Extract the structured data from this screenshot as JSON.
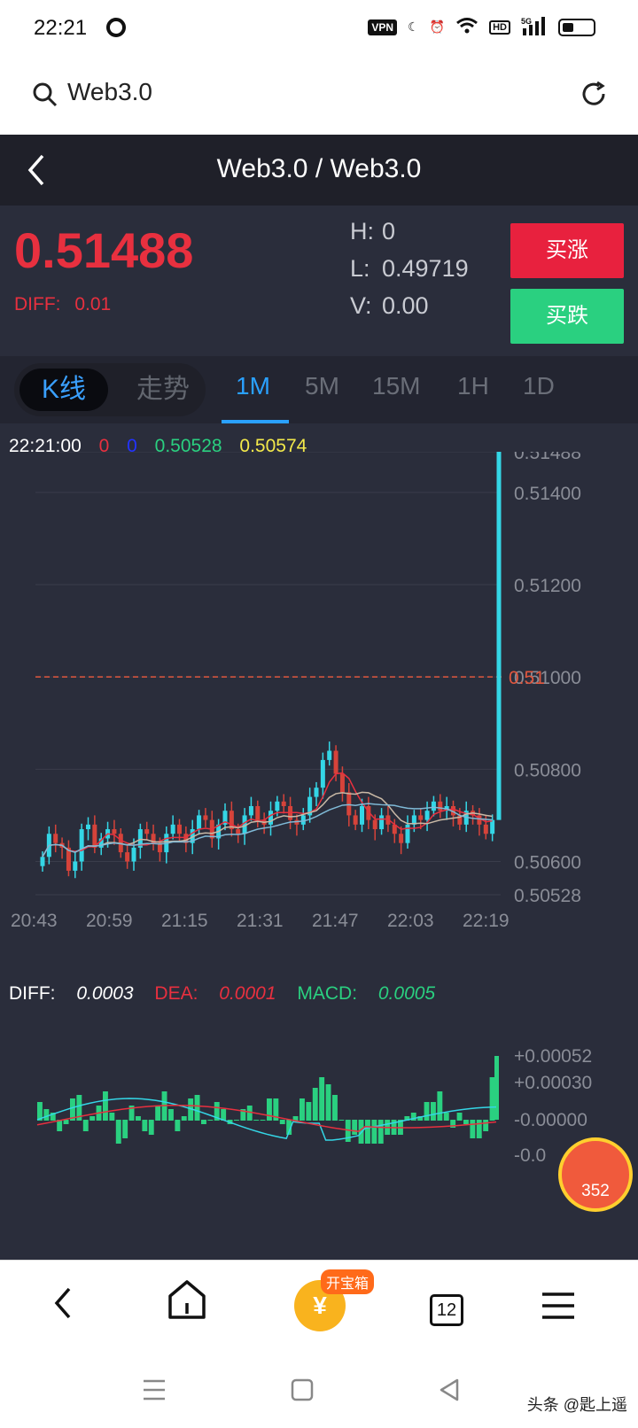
{
  "status_bar": {
    "time": "22:21",
    "vpn": "VPN",
    "hd": "HD",
    "signal": "5G"
  },
  "search": {
    "query": "Web3.0"
  },
  "header": {
    "title": "Web3.0 / Web3.0"
  },
  "quote": {
    "price": "0.51488",
    "diff_label": "DIFF:",
    "diff_value": "0.01",
    "high_label": "H:",
    "high_value": "0",
    "low_label": "L:",
    "low_value": "0.49719",
    "volume_label": "V:",
    "volume_value": "0.00",
    "buy_up_label": "买涨",
    "buy_down_label": "买跌"
  },
  "chart_tabs": {
    "kline": "K线",
    "trend": "走势",
    "periods": [
      "1M",
      "5M",
      "15M",
      "1H",
      "1D"
    ],
    "active_period": "1M"
  },
  "kline_info": {
    "time": "22:21:00",
    "v1": "0",
    "v2": "0",
    "v3": "0.50528",
    "v4": "0.50574"
  },
  "macd_info": {
    "diff_label": "DIFF:",
    "diff_value": "0.0003",
    "dea_label": "DEA:",
    "dea_value": "0.0001",
    "macd_label": "MACD:",
    "macd_value": "0.0005"
  },
  "colors": {
    "up": "#e8303f",
    "down": "#2ad080",
    "cyan": "#34d6e6",
    "accent": "#2aa1ff",
    "bg": "#2a2d3b"
  },
  "chart_data": [
    {
      "type": "candlestick",
      "y_ticks": [
        "0.51488",
        "0.51400",
        "0.51200",
        "0.51000",
        "0.50800",
        "0.50600",
        "0.50528"
      ],
      "x_ticks": [
        "20:43",
        "20:59",
        "21:15",
        "21:31",
        "21:47",
        "22:03",
        "22:19"
      ],
      "ylim": [
        0.50528,
        0.51488
      ],
      "reference_line": 0.51,
      "reference_label": "0.51",
      "last_price": 0.51488,
      "close_series": [
        0.5061,
        0.5066,
        0.5064,
        0.5063,
        0.5058,
        0.506,
        0.5067,
        0.5068,
        0.5063,
        0.5065,
        0.5067,
        0.5066,
        0.5062,
        0.506,
        0.5063,
        0.5067,
        0.5066,
        0.5064,
        0.5062,
        0.5066,
        0.5068,
        0.5066,
        0.5064,
        0.5067,
        0.507,
        0.5069,
        0.5065,
        0.5068,
        0.5071,
        0.5067,
        0.5066,
        0.507,
        0.5072,
        0.5069,
        0.5068,
        0.5071,
        0.5073,
        0.5072,
        0.5069,
        0.5068,
        0.507,
        0.5074,
        0.5076,
        0.5082,
        0.5084,
        0.5079,
        0.5075,
        0.507,
        0.5068,
        0.5072,
        0.5069,
        0.5067,
        0.507,
        0.5068,
        0.5066,
        0.5064,
        0.5068,
        0.507,
        0.5069,
        0.5071,
        0.5073,
        0.5071,
        0.5072,
        0.507,
        0.5068,
        0.5071,
        0.507,
        0.5068,
        0.5066,
        0.5069,
        0.51488
      ]
    },
    {
      "type": "bar",
      "name": "MACD",
      "y_ticks": [
        "+0.00052",
        "+0.00030",
        "-0.00000",
        "-0.0"
      ]
    }
  ],
  "bottom_nav": {
    "treasure_label": "开宝箱",
    "coin_symbol": "¥",
    "tab_count": "12"
  },
  "badge": {
    "count": "352"
  },
  "watermark": "头条 @匙上遥"
}
